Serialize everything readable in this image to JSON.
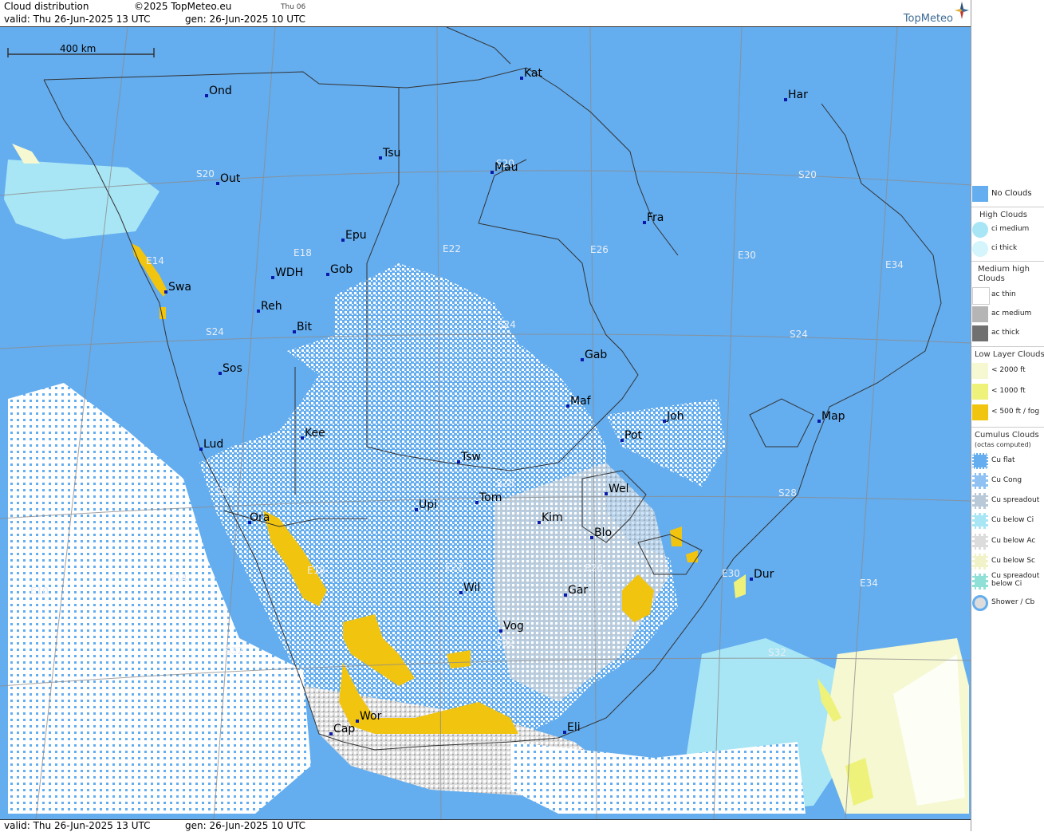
{
  "header": {
    "title": "Cloud distribution",
    "copyright": "©2025 TopMeteo.eu",
    "small_day": "Thu 06",
    "valid": "valid:  Thu  26-Jun-2025  13 UTC",
    "gen": "gen: 26-Jun-2025 10 UTC",
    "brand": "TopMeteo"
  },
  "footer": {
    "valid": "valid:  Thu  26-Jun-2025  13 UTC",
    "gen": "gen: 26-Jun-2025 10 UTC"
  },
  "scale_label": "400 km",
  "colors": {
    "no_clouds": "#64adef",
    "ci_medium": "#a8e6f5",
    "ci_thick": "#d4f5fb",
    "low_2000": "#f5f8d0",
    "low_1000": "#eef27a",
    "low_500": "#f1c40f",
    "cumulus": "#ffffff"
  },
  "cities": [
    {
      "name": "Ond"
    },
    {
      "name": "Kat"
    },
    {
      "name": "Har"
    },
    {
      "name": "Tsu"
    },
    {
      "name": "Out"
    },
    {
      "name": "Mau"
    },
    {
      "name": "Fra"
    },
    {
      "name": "Epu"
    },
    {
      "name": "Gob"
    },
    {
      "name": "WDH"
    },
    {
      "name": "Swa"
    },
    {
      "name": "Reh"
    },
    {
      "name": "Bit"
    },
    {
      "name": "Gab"
    },
    {
      "name": "Sos"
    },
    {
      "name": "Maf"
    },
    {
      "name": "Joh"
    },
    {
      "name": "Map"
    },
    {
      "name": "Kee"
    },
    {
      "name": "Lud"
    },
    {
      "name": "Pot"
    },
    {
      "name": "Tsw"
    },
    {
      "name": "Wel"
    },
    {
      "name": "Tom"
    },
    {
      "name": "Upi"
    },
    {
      "name": "Ora"
    },
    {
      "name": "Kim"
    },
    {
      "name": "Blo"
    },
    {
      "name": "Dur"
    },
    {
      "name": "Wil"
    },
    {
      "name": "Gar"
    },
    {
      "name": "Vog"
    },
    {
      "name": "Wor"
    },
    {
      "name": "Cap"
    },
    {
      "name": "Eli"
    }
  ],
  "grid_labels": [
    "S20",
    "S20",
    "S20",
    "E14",
    "E18",
    "E22",
    "E26",
    "E30",
    "E34",
    "S24",
    "S24",
    "S24",
    "S28",
    "S28",
    "S28",
    "E10",
    "E14",
    "E18",
    "E22",
    "E26",
    "E30",
    "E34",
    "S32",
    "S32",
    "S32"
  ],
  "legend": {
    "no_clouds": "No Clouds",
    "high": {
      "title": "High Clouds",
      "items": [
        "ci medium",
        "ci thick"
      ]
    },
    "medium": {
      "title": "Medium high Clouds",
      "items": [
        "ac thin",
        "ac medium",
        "ac thick"
      ]
    },
    "low": {
      "title": "Low Layer Clouds",
      "items": [
        "< 2000 ft",
        "< 1000 ft",
        "< 500 ft / fog"
      ]
    },
    "cumulus": {
      "title": "Cumulus Clouds",
      "subtitle": "(octas computed)",
      "items": [
        "Cu flat",
        "Cu Cong",
        "Cu spreadout",
        "Cu below Ci",
        "Cu below Ac",
        "Cu below Sc",
        "Cu spreadout below Ci",
        "Shower / Cb"
      ]
    }
  }
}
